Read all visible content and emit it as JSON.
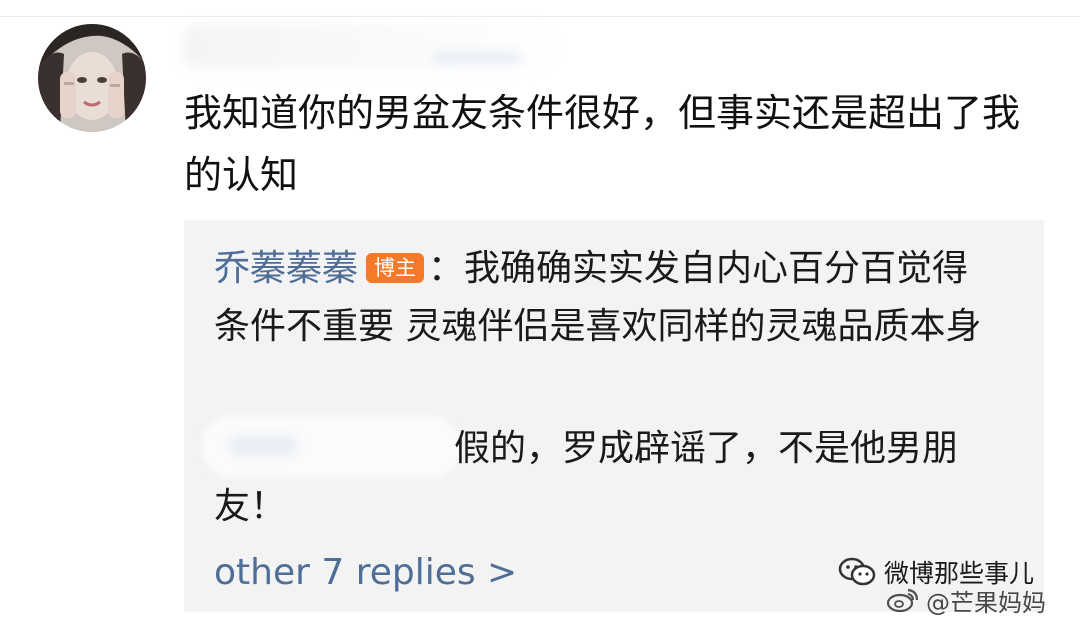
{
  "comment": {
    "text": "我知道你的男盆友条件很好，但事实还是超出了我的认知"
  },
  "replies": [
    {
      "author": "乔蓁蓁蓁",
      "badge": "博主",
      "separator": "：",
      "text": "我确确实实发自内心百分百觉得条件不重要 灵魂伴侣是喜欢同样的灵魂品质本身"
    },
    {
      "text": "假的，罗成辟谣了，不是他男朋友！"
    }
  ],
  "more_replies_label": "other 7 replies >",
  "watermarks": {
    "wechat": "微博那些事儿",
    "weibo": "@芒果妈妈"
  },
  "colors": {
    "link": "#4e6e97",
    "badge": "#f47a2a",
    "reply_bg": "#f3f3f3"
  },
  "icons": {
    "wechat": "wechat-icon",
    "weibo": "weibo-icon"
  }
}
